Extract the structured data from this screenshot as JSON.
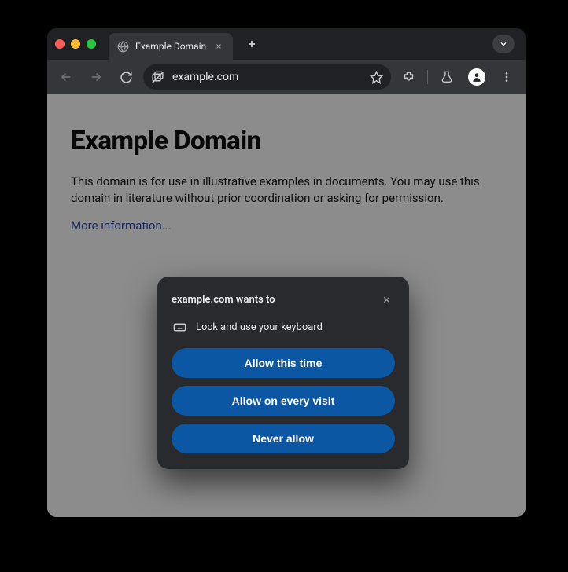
{
  "tab": {
    "title": "Example Domain"
  },
  "omnibox": {
    "url": "example.com"
  },
  "page": {
    "heading": "Example Domain",
    "paragraph": "This domain is for use in illustrative examples in documents. You may use this domain in literature without prior coordination or asking for permission.",
    "link_text": "More information..."
  },
  "permission": {
    "title": "example.com wants to",
    "reason": "Lock and use your keyboard",
    "allow_once": "Allow this time",
    "allow_always": "Allow on every visit",
    "never": "Never allow"
  }
}
